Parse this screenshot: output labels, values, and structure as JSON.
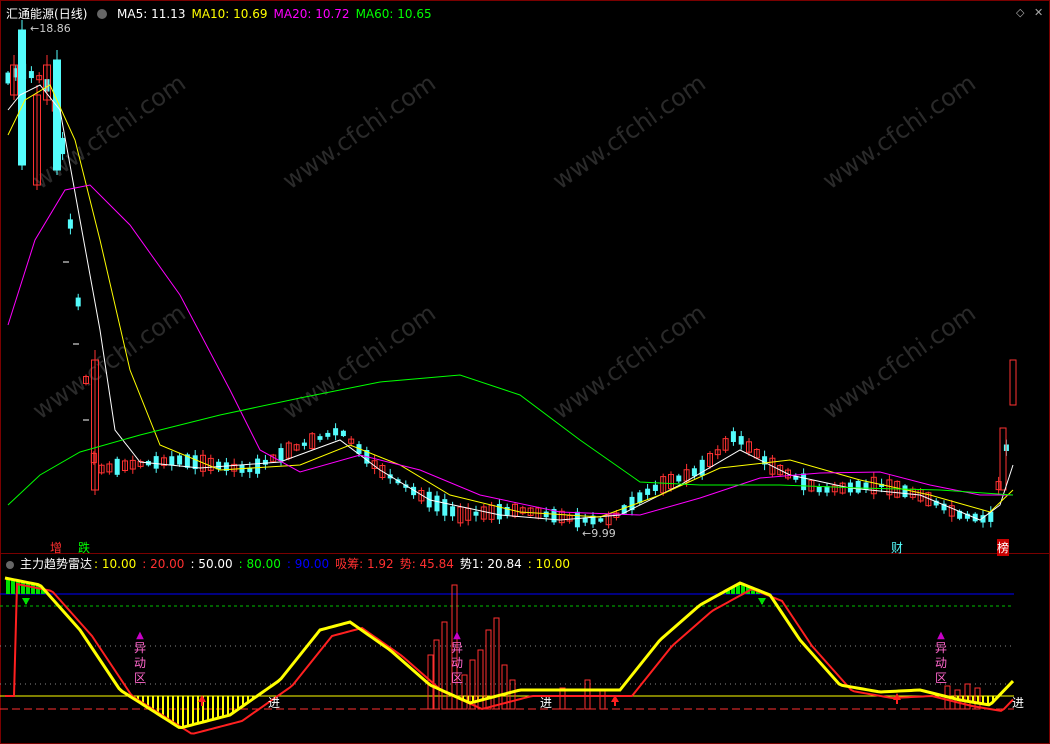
{
  "main": {
    "stock_name": "汇通能源",
    "period": "(日线)",
    "ma": [
      {
        "label": "MA5:",
        "value": "11.13",
        "color": "#ffffff"
      },
      {
        "label": "MA10:",
        "value": "10.69",
        "color": "#ffff00"
      },
      {
        "label": "MA20:",
        "value": "10.72",
        "color": "#ff00ff"
      },
      {
        "label": "MA60:",
        "value": "10.65",
        "color": "#00ff00"
      }
    ],
    "high_label": "18.86",
    "low_label": "9.99",
    "markers": {
      "zeng": "增",
      "die": "跌",
      "cai": "财",
      "bang": "榜"
    }
  },
  "indicator": {
    "name": "主力趋势雷达",
    "values": [
      {
        "text": ": 10.00",
        "color": "#ffff00"
      },
      {
        "text": ": 20.00",
        "color": "#ff3030"
      },
      {
        "text": ": 50.00",
        "color": "#ffffff"
      },
      {
        "text": ": 80.00",
        "color": "#00ff00"
      },
      {
        "text": ": 90.00",
        "color": "#0000ff"
      },
      {
        "text": "吸筹: 1.92",
        "color": "#ff3030"
      },
      {
        "text": "势: 45.84",
        "color": "#ff3030"
      },
      {
        "text": "势1: 20.84",
        "color": "#ffffff"
      },
      {
        "text": ": 10.00",
        "color": "#ffff00"
      }
    ],
    "anomaly_label": [
      "异",
      "动",
      "区"
    ],
    "enter_label": "进"
  },
  "watermark": "www.cfchi.com",
  "colors": {
    "up": "#ff3232",
    "down": "#54fcfc",
    "border": "#7a0000"
  }
}
